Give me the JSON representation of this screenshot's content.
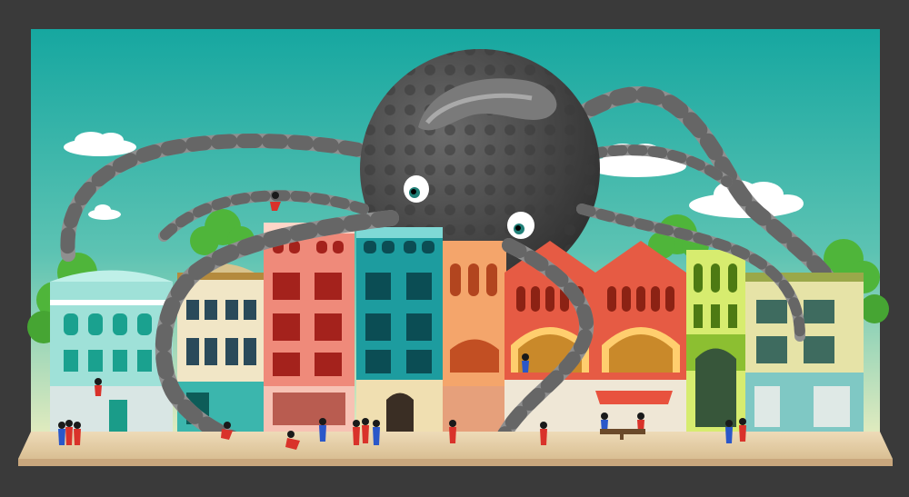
{
  "scene": {
    "colors": {
      "frame": "#3a3a3a",
      "sky_top": "#16a7a0",
      "sky_bottom": "#d8e4b4",
      "sidewalk": "#e9d3ae",
      "curb": "#c9a77d",
      "octopus_body": "#505050",
      "octopus_spot": "#3c3c3c",
      "tentacle_light": "#8f8f8f",
      "tentacle_dark": "#6a6a6a",
      "tree_green": "#4fb53a",
      "person_body": "#1a1a1a",
      "person_red": "#d9322a",
      "person_blue": "#2a57c9"
    },
    "buildings": [
      {
        "name": "mint-villa",
        "wall": "#9fe1d8",
        "trim": "#ffffff",
        "window": "#1aa18f"
      },
      {
        "name": "cream-townhouse",
        "wall": "#f1e6c6",
        "trim": "#b48a3d",
        "window": "#2a4a5a"
      },
      {
        "name": "coral-tower",
        "wall": "#ef8a7a",
        "trim": "#ffd6c8",
        "window": "#a4221c"
      },
      {
        "name": "teal-tower",
        "wall": "#1d9c9f",
        "trim": "#7fd9d6",
        "window": "#0b4d54"
      },
      {
        "name": "salmon-arches",
        "wall": "#f4a56b",
        "trim": "#ffe0b0",
        "window": "#b2451f"
      },
      {
        "name": "red-hall-left",
        "wall": "#e65b44",
        "trim": "#ffce6e",
        "window": "#8c2214"
      },
      {
        "name": "red-hall-right",
        "wall": "#e65b44",
        "trim": "#ffce6e",
        "window": "#8c2214"
      },
      {
        "name": "lime-house",
        "wall": "#d7ec6f",
        "trim": "#8cbf31",
        "window": "#4d7a13"
      },
      {
        "name": "sand-townhouse",
        "wall": "#e6e3a7",
        "trim": "#9aa84a",
        "window": "#3e6b5f"
      }
    ]
  }
}
